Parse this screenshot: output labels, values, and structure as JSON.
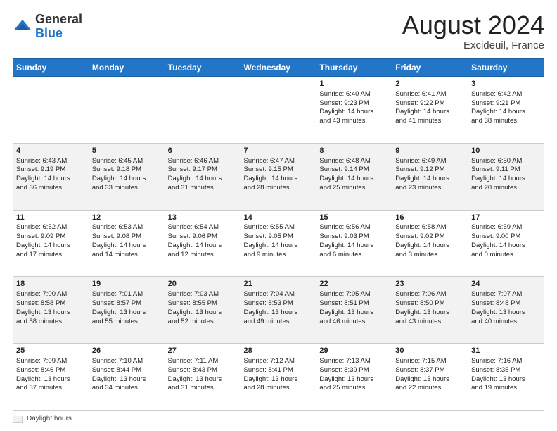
{
  "header": {
    "logo_general": "General",
    "logo_blue": "Blue",
    "month_title": "August 2024",
    "location": "Excideuil, France"
  },
  "footer": {
    "label": "Daylight hours"
  },
  "weekdays": [
    "Sunday",
    "Monday",
    "Tuesday",
    "Wednesday",
    "Thursday",
    "Friday",
    "Saturday"
  ],
  "weeks": [
    [
      {
        "day": "",
        "info": ""
      },
      {
        "day": "",
        "info": ""
      },
      {
        "day": "",
        "info": ""
      },
      {
        "day": "",
        "info": ""
      },
      {
        "day": "1",
        "info": "Sunrise: 6:40 AM\nSunset: 9:23 PM\nDaylight: 14 hours\nand 43 minutes."
      },
      {
        "day": "2",
        "info": "Sunrise: 6:41 AM\nSunset: 9:22 PM\nDaylight: 14 hours\nand 41 minutes."
      },
      {
        "day": "3",
        "info": "Sunrise: 6:42 AM\nSunset: 9:21 PM\nDaylight: 14 hours\nand 38 minutes."
      }
    ],
    [
      {
        "day": "4",
        "info": "Sunrise: 6:43 AM\nSunset: 9:19 PM\nDaylight: 14 hours\nand 36 minutes."
      },
      {
        "day": "5",
        "info": "Sunrise: 6:45 AM\nSunset: 9:18 PM\nDaylight: 14 hours\nand 33 minutes."
      },
      {
        "day": "6",
        "info": "Sunrise: 6:46 AM\nSunset: 9:17 PM\nDaylight: 14 hours\nand 31 minutes."
      },
      {
        "day": "7",
        "info": "Sunrise: 6:47 AM\nSunset: 9:15 PM\nDaylight: 14 hours\nand 28 minutes."
      },
      {
        "day": "8",
        "info": "Sunrise: 6:48 AM\nSunset: 9:14 PM\nDaylight: 14 hours\nand 25 minutes."
      },
      {
        "day": "9",
        "info": "Sunrise: 6:49 AM\nSunset: 9:12 PM\nDaylight: 14 hours\nand 23 minutes."
      },
      {
        "day": "10",
        "info": "Sunrise: 6:50 AM\nSunset: 9:11 PM\nDaylight: 14 hours\nand 20 minutes."
      }
    ],
    [
      {
        "day": "11",
        "info": "Sunrise: 6:52 AM\nSunset: 9:09 PM\nDaylight: 14 hours\nand 17 minutes."
      },
      {
        "day": "12",
        "info": "Sunrise: 6:53 AM\nSunset: 9:08 PM\nDaylight: 14 hours\nand 14 minutes."
      },
      {
        "day": "13",
        "info": "Sunrise: 6:54 AM\nSunset: 9:06 PM\nDaylight: 14 hours\nand 12 minutes."
      },
      {
        "day": "14",
        "info": "Sunrise: 6:55 AM\nSunset: 9:05 PM\nDaylight: 14 hours\nand 9 minutes."
      },
      {
        "day": "15",
        "info": "Sunrise: 6:56 AM\nSunset: 9:03 PM\nDaylight: 14 hours\nand 6 minutes."
      },
      {
        "day": "16",
        "info": "Sunrise: 6:58 AM\nSunset: 9:02 PM\nDaylight: 14 hours\nand 3 minutes."
      },
      {
        "day": "17",
        "info": "Sunrise: 6:59 AM\nSunset: 9:00 PM\nDaylight: 14 hours\nand 0 minutes."
      }
    ],
    [
      {
        "day": "18",
        "info": "Sunrise: 7:00 AM\nSunset: 8:58 PM\nDaylight: 13 hours\nand 58 minutes."
      },
      {
        "day": "19",
        "info": "Sunrise: 7:01 AM\nSunset: 8:57 PM\nDaylight: 13 hours\nand 55 minutes."
      },
      {
        "day": "20",
        "info": "Sunrise: 7:03 AM\nSunset: 8:55 PM\nDaylight: 13 hours\nand 52 minutes."
      },
      {
        "day": "21",
        "info": "Sunrise: 7:04 AM\nSunset: 8:53 PM\nDaylight: 13 hours\nand 49 minutes."
      },
      {
        "day": "22",
        "info": "Sunrise: 7:05 AM\nSunset: 8:51 PM\nDaylight: 13 hours\nand 46 minutes."
      },
      {
        "day": "23",
        "info": "Sunrise: 7:06 AM\nSunset: 8:50 PM\nDaylight: 13 hours\nand 43 minutes."
      },
      {
        "day": "24",
        "info": "Sunrise: 7:07 AM\nSunset: 8:48 PM\nDaylight: 13 hours\nand 40 minutes."
      }
    ],
    [
      {
        "day": "25",
        "info": "Sunrise: 7:09 AM\nSunset: 8:46 PM\nDaylight: 13 hours\nand 37 minutes."
      },
      {
        "day": "26",
        "info": "Sunrise: 7:10 AM\nSunset: 8:44 PM\nDaylight: 13 hours\nand 34 minutes."
      },
      {
        "day": "27",
        "info": "Sunrise: 7:11 AM\nSunset: 8:43 PM\nDaylight: 13 hours\nand 31 minutes."
      },
      {
        "day": "28",
        "info": "Sunrise: 7:12 AM\nSunset: 8:41 PM\nDaylight: 13 hours\nand 28 minutes."
      },
      {
        "day": "29",
        "info": "Sunrise: 7:13 AM\nSunset: 8:39 PM\nDaylight: 13 hours\nand 25 minutes."
      },
      {
        "day": "30",
        "info": "Sunrise: 7:15 AM\nSunset: 8:37 PM\nDaylight: 13 hours\nand 22 minutes."
      },
      {
        "day": "31",
        "info": "Sunrise: 7:16 AM\nSunset: 8:35 PM\nDaylight: 13 hours\nand 19 minutes."
      }
    ]
  ]
}
